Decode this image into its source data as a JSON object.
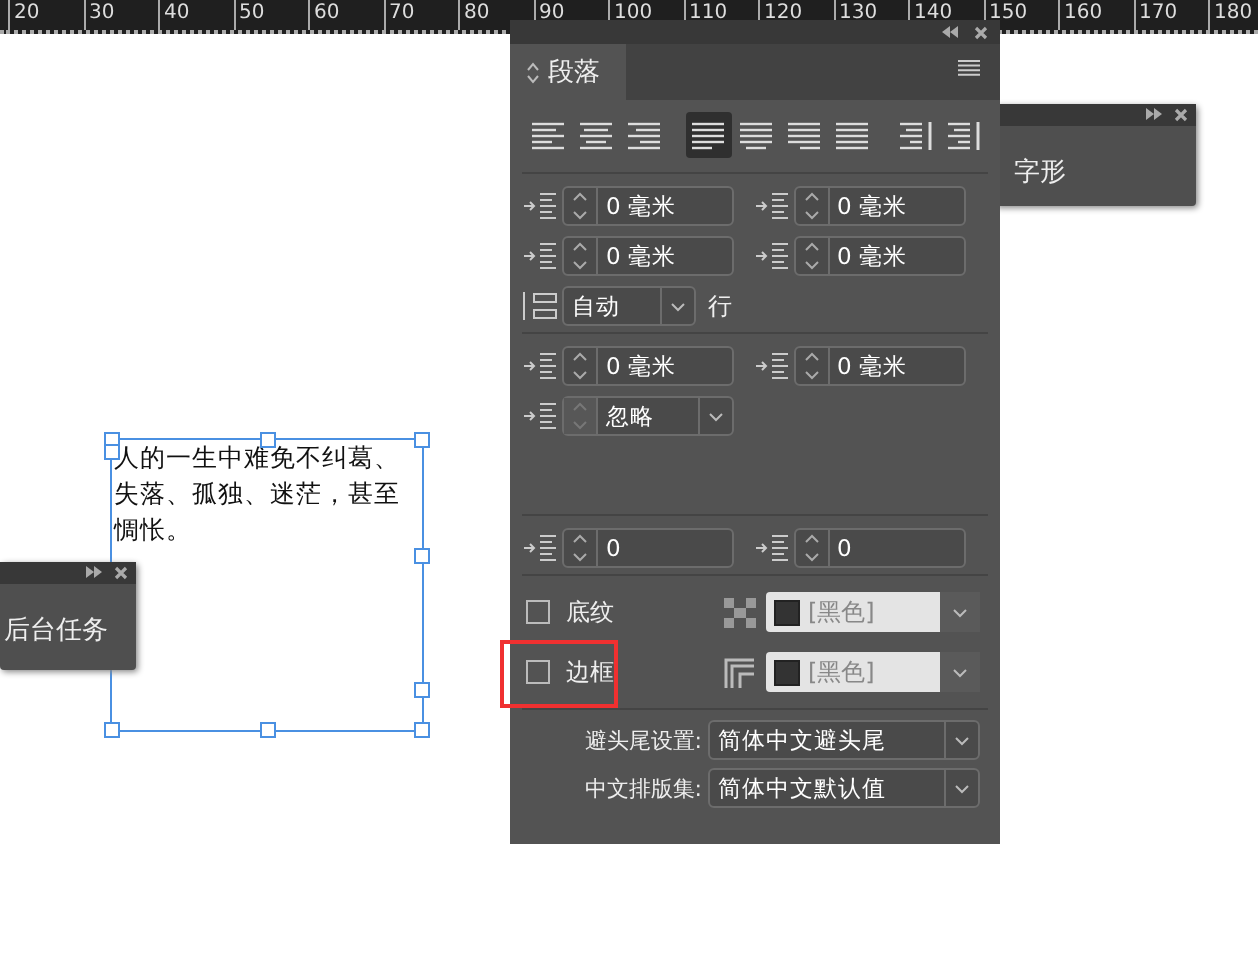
{
  "ruler": {
    "labels": [
      "20",
      "30",
      "40",
      "50",
      "60",
      "70",
      "80",
      "90",
      "100",
      "110",
      "120",
      "130",
      "140",
      "150",
      "160",
      "170",
      "180"
    ]
  },
  "text_frame": {
    "text": "人的一生中难免不纠葛、失落、孤独、迷茫，甚至惆怅。"
  },
  "paragraph_panel": {
    "tab": "段落",
    "alignment_buttons": [
      {
        "kind": "left",
        "selected": false
      },
      {
        "kind": "center",
        "selected": false
      },
      {
        "kind": "right",
        "selected": false
      },
      {
        "kind": "justify-left",
        "selected": true
      },
      {
        "kind": "justify-center",
        "selected": false
      },
      {
        "kind": "justify-right",
        "selected": false
      },
      {
        "kind": "justify-all",
        "selected": false
      },
      {
        "kind": "toward-spine",
        "selected": false
      },
      {
        "kind": "away-spine",
        "selected": false
      }
    ],
    "left_indent": "0 毫米",
    "right_indent": "0 毫米",
    "first_line_indent": "0 毫米",
    "last_line_indent": "0 毫米",
    "grid_align": "自动",
    "grid_unit": "行",
    "space_before": "0 毫米",
    "space_after": "0 毫米",
    "drop_cap": "忽略",
    "drop_cap_lines": "0",
    "drop_cap_chars": "0",
    "shading": {
      "label": "底纹",
      "checked": false,
      "color_name": "[黑色]"
    },
    "border": {
      "label": "边框",
      "checked": false,
      "color_name": "[黑色]"
    },
    "kinsoku_label": "避头尾设置:",
    "kinsoku_value": "简体中文避头尾",
    "mojikumi_label": "中文排版集:",
    "mojikumi_value": "简体中文默认值"
  },
  "glyphs_panel": {
    "title": "字形"
  },
  "background_tasks_panel": {
    "title": "后台任务"
  }
}
